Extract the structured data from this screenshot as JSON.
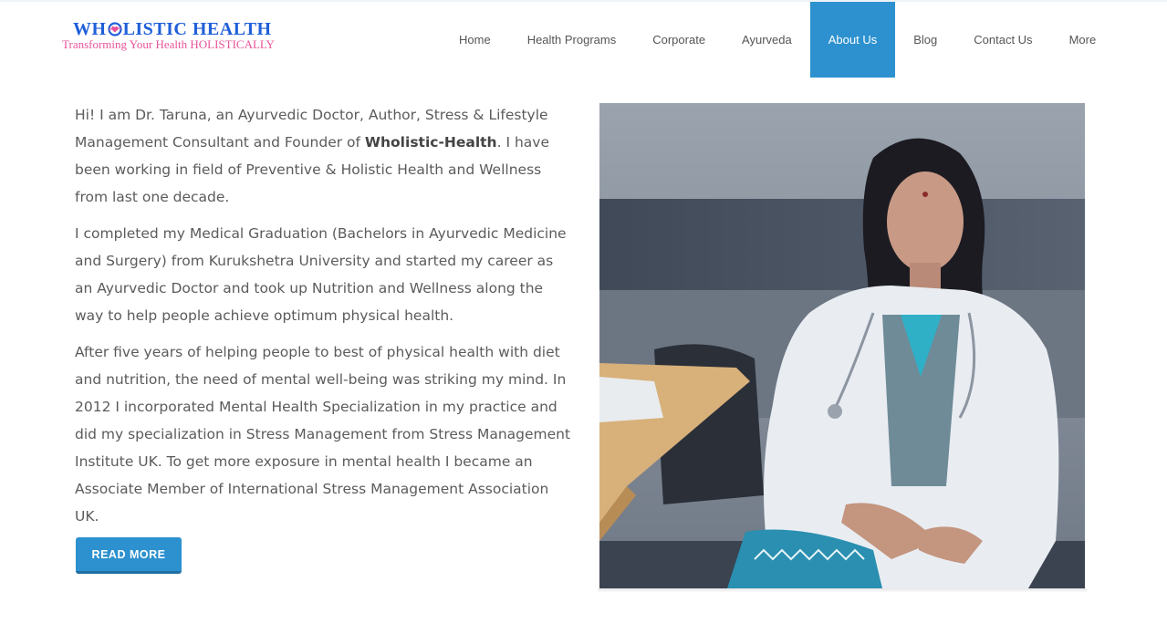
{
  "brand": {
    "title_prefix": "WH",
    "title_suffix": "LISTIC HEALTH",
    "tagline": "Transforming Your Health HOLISTICALLY",
    "title_color": "#1f5fd9",
    "tagline_color": "#e8539a"
  },
  "nav": {
    "items": [
      {
        "label": "Home",
        "active": false
      },
      {
        "label": "Health Programs",
        "active": false
      },
      {
        "label": "Corporate",
        "active": false
      },
      {
        "label": "Ayurveda",
        "active": false
      },
      {
        "label": "About Us",
        "active": true
      },
      {
        "label": "Blog",
        "active": false
      },
      {
        "label": "Contact Us",
        "active": false
      },
      {
        "label": "More",
        "active": false
      }
    ],
    "active_color": "#2d91cf"
  },
  "about": {
    "p1_before": "Hi! I am Dr. Taruna, an Ayurvedic Doctor, Author, Stress & Lifestyle Management Consultant and Founder of ",
    "p1_bold": "Wholistic-Health",
    "p1_after": ". I have been working in field of Preventive & Holistic Health and Wellness from last one decade.",
    "p2": "I completed my Medical Graduation (Bachelors in Ayurvedic Medicine and Surgery) from Kurukshetra University and started my career as an Ayurvedic Doctor and took up Nutrition and Wellness along the way to help people achieve optimum physical health.",
    "p3": "After five years of helping people to best of physical health with diet and nutrition, the need of mental well-being was striking my mind. In 2012 I incorporated Mental Health Specialization in my practice and did my specialization in Stress Management from Stress Management Institute UK. To get more exposure in mental health I became an Associate Member of International Stress Management Association UK."
  },
  "read_more": {
    "label": "READ MORE"
  },
  "photo": {
    "icon": "doctor-portrait-photo"
  }
}
